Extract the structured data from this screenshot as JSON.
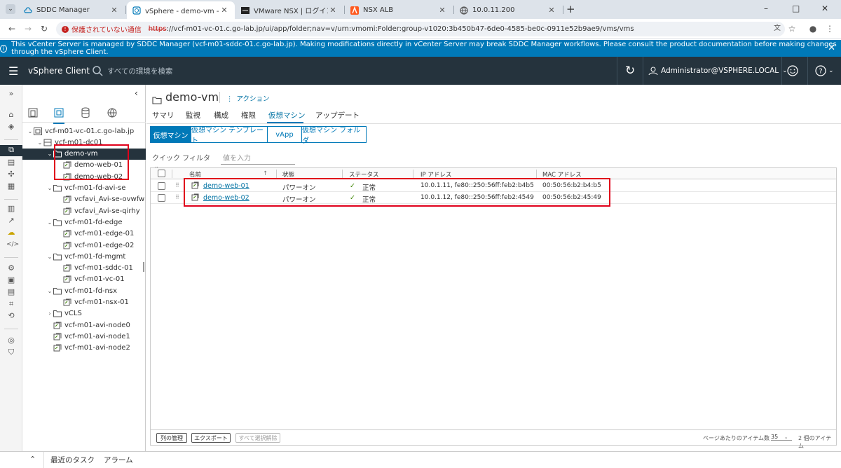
{
  "browser": {
    "tabs": [
      {
        "label": "SDDC Manager",
        "icon": "sddc-cloud-icon",
        "active": false
      },
      {
        "label": "vSphere - demo-vm - 仮想マシン",
        "icon": "vsphere-icon",
        "active": true
      },
      {
        "label": "VMware NSX | ログイン",
        "icon": "nsx-icon",
        "active": false
      },
      {
        "label": "NSX ALB",
        "icon": "alb-icon",
        "active": false
      },
      {
        "label": "10.0.11.200",
        "icon": "globe-icon",
        "active": false
      }
    ],
    "new_tab": "+",
    "window_controls": [
      "–",
      "□",
      "✕"
    ],
    "security_label": "保護されていない通信",
    "url_scheme": "https",
    "url_rest": "://vcf-m01-vc-01.c.go-lab.jp/ui/app/folder;nav=v/urn:vmomi:Folder:group-v1020:3b450b47-6de0-4585-be0c-0911e52b9ae9/vms/vms"
  },
  "banner": {
    "text": "This vCenter Server is managed by SDDC Manager (vcf-m01-sddc-01.c.go-lab.jp). Making modifications directly in vCenter Server may break SDDC Manager workflows. Please consult the product documentation before making changes through the vSphere Client."
  },
  "header": {
    "app_title": "vSphere Client",
    "search_placeholder": "すべての環境を検索",
    "user": "Administrator@VSPHERE.LOCAL"
  },
  "tree": {
    "items": [
      {
        "label": "vcf-m01-vc-01.c.go-lab.jp",
        "indent": 0,
        "caret": "v",
        "icon": "vcenter-icon"
      },
      {
        "label": "vcf-m01-dc01",
        "indent": 1,
        "caret": "v",
        "icon": "datacenter-icon"
      },
      {
        "label": "demo-vm",
        "indent": 2,
        "caret": "v",
        "icon": "folder-icon",
        "selected": true
      },
      {
        "label": "demo-web-01",
        "indent": 3,
        "caret": "",
        "icon": "vm-icon"
      },
      {
        "label": "demo-web-02",
        "indent": 3,
        "caret": "",
        "icon": "vm-icon"
      },
      {
        "label": "vcf-m01-fd-avi-se",
        "indent": 2,
        "caret": "v",
        "icon": "folder-icon"
      },
      {
        "label": "vcfavi_Avi-se-ovwfw",
        "indent": 3,
        "caret": "",
        "icon": "vm-icon"
      },
      {
        "label": "vcfavi_Avi-se-qirhy",
        "indent": 3,
        "caret": "",
        "icon": "vm-icon"
      },
      {
        "label": "vcf-m01-fd-edge",
        "indent": 2,
        "caret": "v",
        "icon": "folder-icon"
      },
      {
        "label": "vcf-m01-edge-01",
        "indent": 3,
        "caret": "",
        "icon": "vm-icon"
      },
      {
        "label": "vcf-m01-edge-02",
        "indent": 3,
        "caret": "",
        "icon": "vm-icon"
      },
      {
        "label": "vcf-m01-fd-mgmt",
        "indent": 2,
        "caret": "v",
        "icon": "folder-icon"
      },
      {
        "label": "vcf-m01-sddc-01",
        "indent": 3,
        "caret": "",
        "icon": "vm-icon"
      },
      {
        "label": "vcf-m01-vc-01",
        "indent": 3,
        "caret": "",
        "icon": "vm-icon"
      },
      {
        "label": "vcf-m01-fd-nsx",
        "indent": 2,
        "caret": "v",
        "icon": "folder-icon"
      },
      {
        "label": "vcf-m01-nsx-01",
        "indent": 3,
        "caret": "",
        "icon": "vm-icon"
      },
      {
        "label": "vCLS",
        "indent": 2,
        "caret": ">",
        "icon": "folder-icon"
      },
      {
        "label": "vcf-m01-avi-node0",
        "indent": 2,
        "caret": "",
        "icon": "vm-icon"
      },
      {
        "label": "vcf-m01-avi-node1",
        "indent": 2,
        "caret": "",
        "icon": "vm-icon"
      },
      {
        "label": "vcf-m01-avi-node2",
        "indent": 2,
        "caret": "",
        "icon": "vm-icon"
      }
    ]
  },
  "content": {
    "title": "demo-vm",
    "actions": "アクション",
    "tabs": [
      "サマリ",
      "監視",
      "構成",
      "権限",
      "仮想マシン",
      "アップデート"
    ],
    "active_tab": "仮想マシン",
    "subtabs": [
      "仮想マシン",
      "仮想マシン テンプレート",
      "vApp",
      "仮想マシン フォルダ"
    ],
    "quick_filter": "クイック フィルタ",
    "filter_placeholder": "値を入力",
    "columns": [
      "名前",
      "状態",
      "ステータス",
      "IP アドレス",
      "MAC アドレス"
    ],
    "rows": [
      {
        "name": "demo-web-01",
        "state": "パワーオン",
        "status": "正常",
        "ip": "10.0.1.11, fe80::250:56ff:feb2:b4b5",
        "mac": "00:50:56:b2:b4:b5"
      },
      {
        "name": "demo-web-02",
        "state": "パワーオン",
        "status": "正常",
        "ip": "10.0.1.12, fe80::250:56ff:feb2:4549",
        "mac": "00:50:56:b2:45:49"
      }
    ],
    "footer": {
      "manage_columns": "列の管理",
      "export": "エクスポート",
      "deselect_all": "すべて選択解除",
      "per_page_label": "ページあたりのアイテム数",
      "per_page": "35",
      "count": "2 個のアイテム"
    }
  },
  "bottom": {
    "recent_tasks": "最近のタスク",
    "alarms": "アラーム"
  },
  "colors": {
    "accent": "#0079b8",
    "header": "#25333d",
    "highlight": "#e0001b",
    "ok": "#3c8500"
  }
}
